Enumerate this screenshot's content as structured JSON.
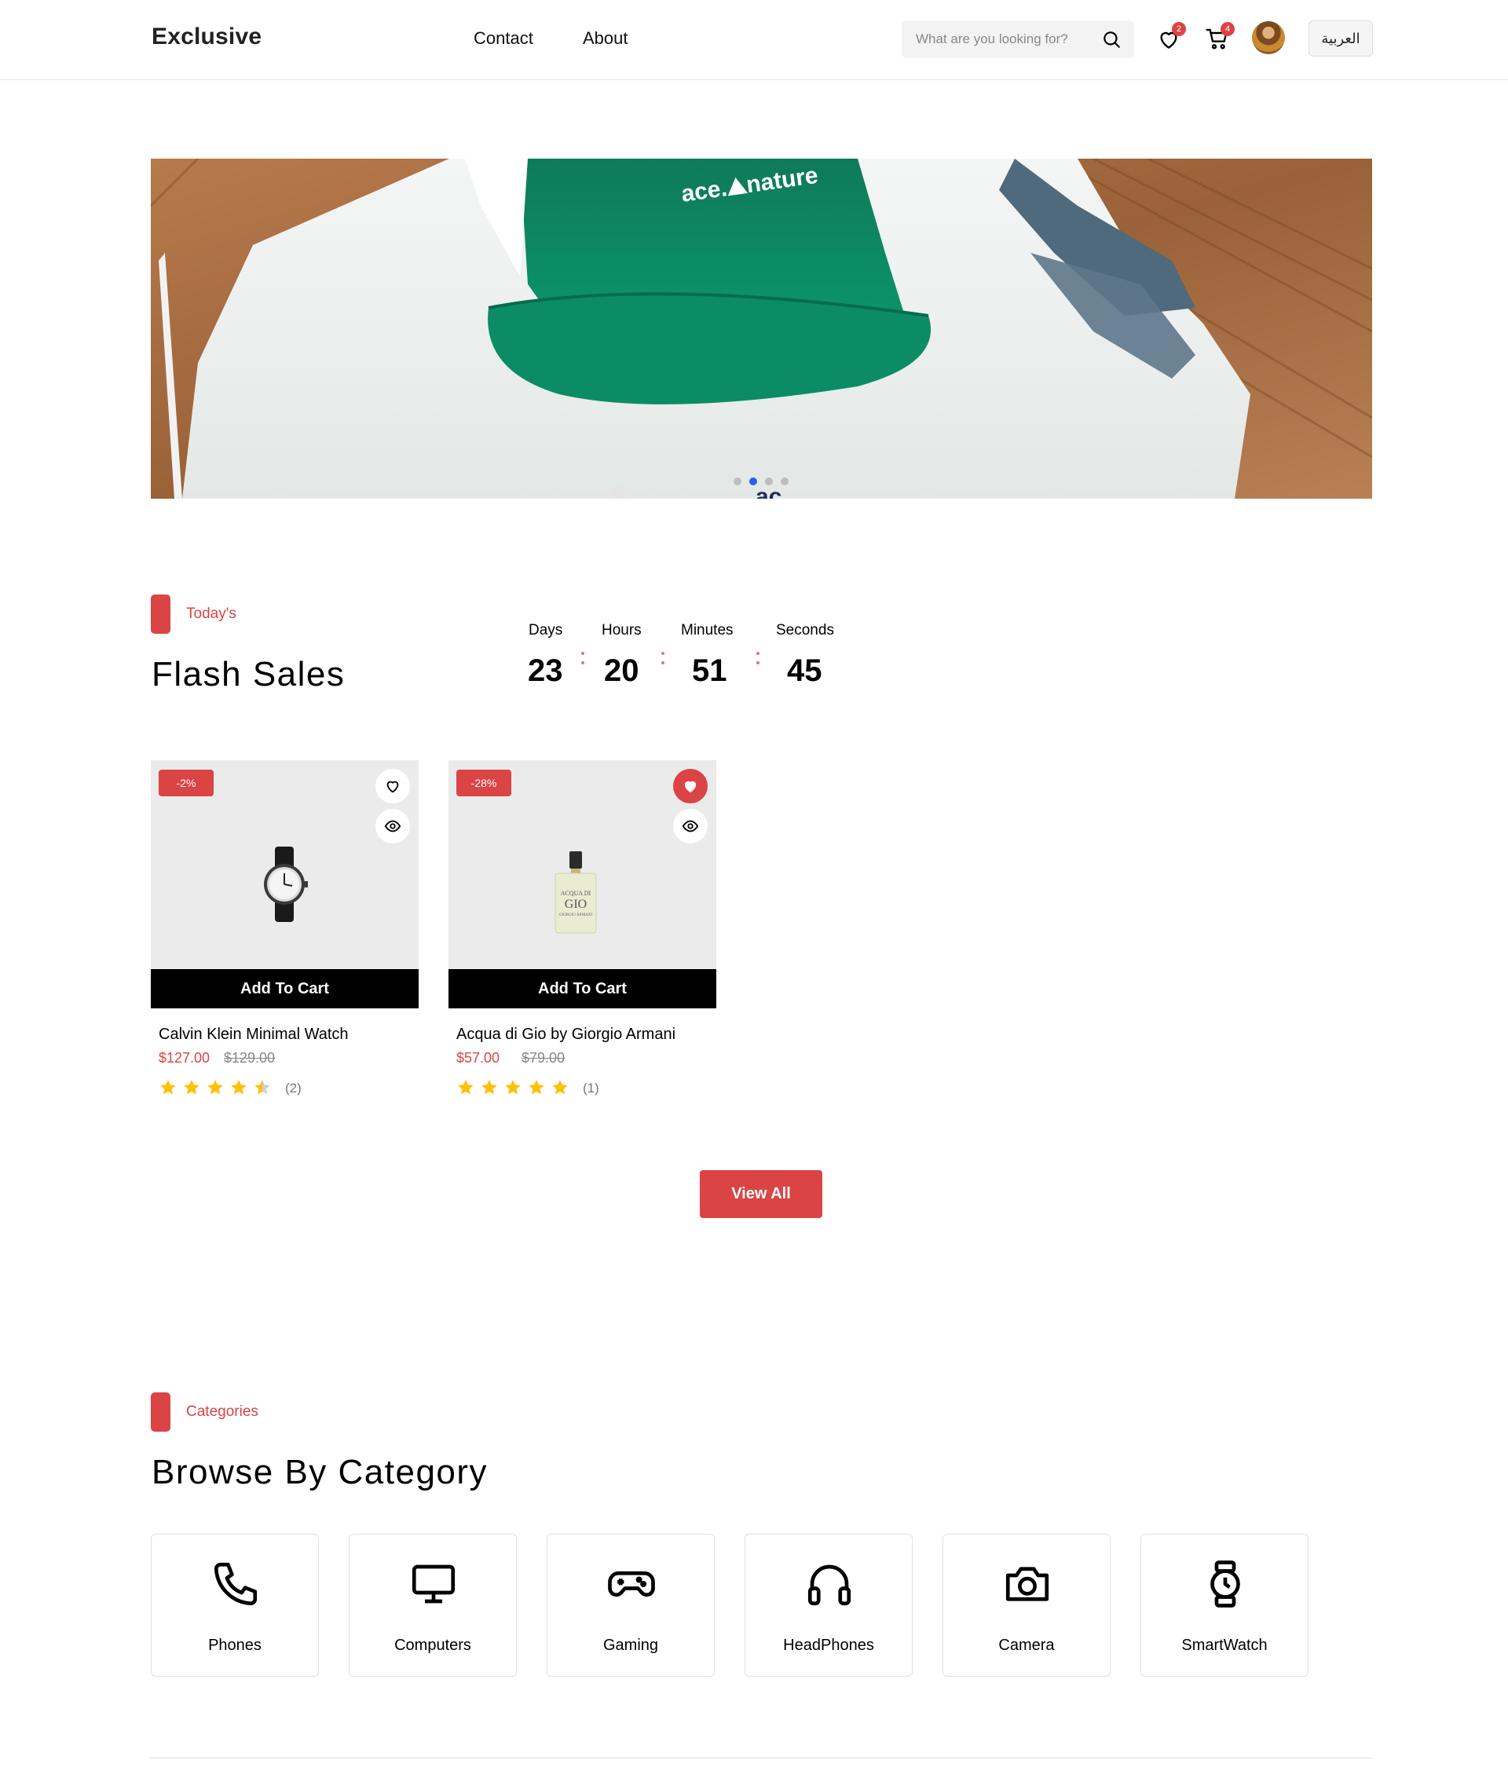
{
  "header": {
    "logo": "Exclusive",
    "nav": [
      {
        "label": "Contact"
      },
      {
        "label": "About"
      }
    ],
    "search": {
      "placeholder": "What are you looking for?",
      "icon": "search-icon"
    },
    "wishlist": {
      "icon": "heart-icon",
      "count": "2"
    },
    "cart": {
      "icon": "cart-icon",
      "count": "4"
    },
    "language_button": "العربية"
  },
  "hero": {
    "slide_count": 4,
    "active_slide": 2,
    "cap_text": "ace.nature"
  },
  "flash_sales": {
    "tag": "Today's",
    "title": "Flash Sales",
    "countdown": [
      {
        "label": "Days",
        "value": "23"
      },
      {
        "label": "Hours",
        "value": "20"
      },
      {
        "label": "Minutes",
        "value": "51"
      },
      {
        "label": "Seconds",
        "value": "45"
      }
    ],
    "products": [
      {
        "discount": "-2%",
        "name": "Calvin Klein Minimal Watch",
        "price": "$127.00",
        "old_price": "$129.00",
        "rating": 4.5,
        "reviews": "(2)",
        "favorited": false,
        "add_to_cart": "Add To Cart"
      },
      {
        "discount": "-28%",
        "name": "Acqua di Gio by Giorgio Armani",
        "price": "$57.00",
        "old_price": "$79.00",
        "rating": 5,
        "reviews": "(1)",
        "favorited": true,
        "add_to_cart": "Add To Cart"
      }
    ],
    "view_all": "View All"
  },
  "categories": {
    "tag": "Categories",
    "title": "Browse By Category",
    "items": [
      {
        "label": "Phones",
        "icon": "phone-icon"
      },
      {
        "label": "Computers",
        "icon": "computer-icon"
      },
      {
        "label": "Gaming",
        "icon": "gamepad-icon"
      },
      {
        "label": "HeadPhones",
        "icon": "headphones-icon"
      },
      {
        "label": "Camera",
        "icon": "camera-icon"
      },
      {
        "label": "SmartWatch",
        "icon": "smartwatch-icon"
      }
    ]
  },
  "colors": {
    "accent": "#db4444",
    "active_dot": "#2563eb",
    "star": "#ffc107"
  }
}
